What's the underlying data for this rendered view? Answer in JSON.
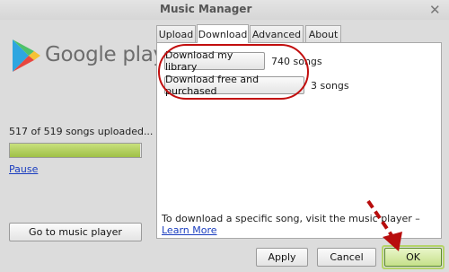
{
  "window": {
    "title": "Music Manager",
    "close_glyph": "✕"
  },
  "brand": {
    "logo_text": "Google play",
    "logo_icon": "google-play-triangle"
  },
  "upload": {
    "status_text": "517 of 519 songs uploaded...",
    "uploaded": 517,
    "total": 519,
    "progress_fraction": 0.9961,
    "pause_label": "Pause"
  },
  "go_to_player_label": "Go to music player",
  "tabs": [
    {
      "label": "Upload",
      "active": false
    },
    {
      "label": "Download",
      "active": true
    },
    {
      "label": "Advanced",
      "active": false
    },
    {
      "label": "About",
      "active": false
    }
  ],
  "download": {
    "library_button": "Download my library",
    "library_count": "740 songs",
    "free_button": "Download free and purchased",
    "free_count": "3 songs",
    "info_text": "To download a specific song, visit the music player – ",
    "learn_more": "Learn More"
  },
  "footer": {
    "apply_label": "Apply",
    "cancel_label": "Cancel",
    "ok_label": "OK"
  },
  "colors": {
    "highlight": "#c20e0e",
    "progress": "#9fc046",
    "link": "#1a3dbf"
  }
}
